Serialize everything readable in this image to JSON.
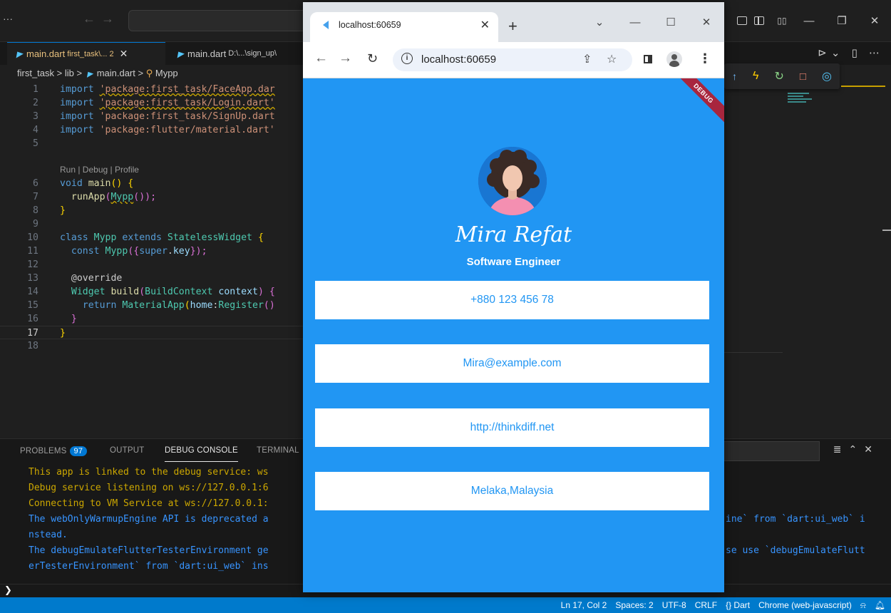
{
  "vscode": {
    "tabs": [
      {
        "name": "main.dart",
        "path": "first_task\\...",
        "problems": "2"
      },
      {
        "name": "main.dart",
        "path": "D:\\...\\sign_up\\"
      }
    ],
    "breadcrumb": {
      "folder1": "first_task",
      "folder2": "lib",
      "file": "main.dart",
      "symbol": "Mypp"
    },
    "code_lens": "Run | Debug | Profile",
    "lines": {
      "l1_kw": "import",
      "l1_str": "'package:first_task/FaceApp.dar",
      "l2_kw": "import",
      "l2_str": "'package:first_task/Login.dart'",
      "l3_kw": "import",
      "l3_str": "'package:first_task/SignUp.dart",
      "l4_kw": "import",
      "l4_str": "'package:flutter/material.dart'",
      "l6_a": "void",
      "l6_b": "main",
      "l6_c": "() {",
      "l7_a": "runApp",
      "l7_b": "(",
      "l7_c": "Mypp",
      "l7_d": "());",
      "l8": "}",
      "l10_a": "class",
      "l10_b": "Mypp",
      "l10_c": "extends",
      "l10_d": "StatelessWidget",
      "l10_e": "{",
      "l11_a": "const",
      "l11_b": "Mypp",
      "l11_c": "({",
      "l11_d": "super",
      "l11_e": ".",
      "l11_f": "key",
      "l11_g": "});",
      "l13": "@override",
      "l14_a": "Widget",
      "l14_b": "build",
      "l14_c": "(",
      "l14_d": "BuildContext",
      "l14_e": "context",
      "l14_f": ") {",
      "l15_a": "return",
      "l15_b": "MaterialApp",
      "l15_c": "(",
      "l15_d": "home",
      "l15_e": ":",
      "l15_f": "Register",
      "l15_g": "()",
      "l16": "}",
      "l17": "}"
    },
    "line_numbers": [
      "1",
      "2",
      "3",
      "4",
      "5",
      "6",
      "7",
      "8",
      "9",
      "10",
      "11",
      "12",
      "13",
      "14",
      "15",
      "16",
      "17",
      "18"
    ],
    "panel_tabs": {
      "problems": "PROBLEMS",
      "problems_count": "97",
      "output": "OUTPUT",
      "debug_console": "DEBUG CONSOLE",
      "terminal": "TERMINAL"
    },
    "console": [
      "This app is linked to the debug service: ws",
      "Debug service listening on ws://127.0.0.1:6",
      "Connecting to VM Service at ws://127.0.0.1:",
      "The webOnlyWarmupEngine API is deprecated a",
      "nstead.",
      "The debugEmulateFlutterTesterEnvironment ge",
      "erTesterEnvironment` from `dart:ui_web` ins"
    ],
    "console_right": [
      "ine` from `dart:ui_web` i",
      "se use `debugEmulateFlutt"
    ],
    "status": {
      "position": "Ln 17, Col 2",
      "spaces": "Spaces: 2",
      "encoding": "UTF-8",
      "eol": "CRLF",
      "language": "{} Dart",
      "device": "Chrome (web-javascript)"
    }
  },
  "browser": {
    "tab_title": "localhost:60659",
    "url": "localhost:60659"
  },
  "app": {
    "debug_banner": "DEBUG",
    "name": "Mira Refat",
    "role": "Software Engineer",
    "cards": {
      "phone": "+880 123 456 78",
      "email": "Mira@example.com",
      "website": "http://thinkdiff.net",
      "location": "Melaka,Malaysia"
    }
  }
}
